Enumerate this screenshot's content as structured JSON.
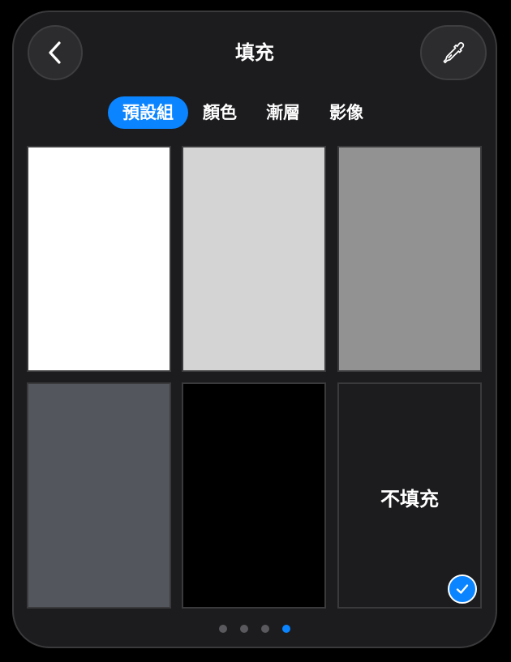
{
  "header": {
    "title": "填充",
    "back_icon": "chevron-left-icon",
    "picker_icon": "eyedropper-icon"
  },
  "tabs": [
    {
      "label": "預設組",
      "active": true
    },
    {
      "label": "顏色",
      "active": false
    },
    {
      "label": "漸層",
      "active": false
    },
    {
      "label": "影像",
      "active": false
    }
  ],
  "swatches": [
    {
      "color": "#ffffff"
    },
    {
      "color": "#d4d4d4"
    },
    {
      "color": "#929292"
    },
    {
      "color": "#53575d"
    },
    {
      "color": "#000000"
    },
    {
      "color": "#1c1c1e",
      "label": "不填充",
      "selected": true
    }
  ],
  "pager": {
    "pages": 4,
    "current_page": 4
  },
  "colors": {
    "accent": "#0a84ff",
    "panel_bg": "#1c1c1e"
  }
}
